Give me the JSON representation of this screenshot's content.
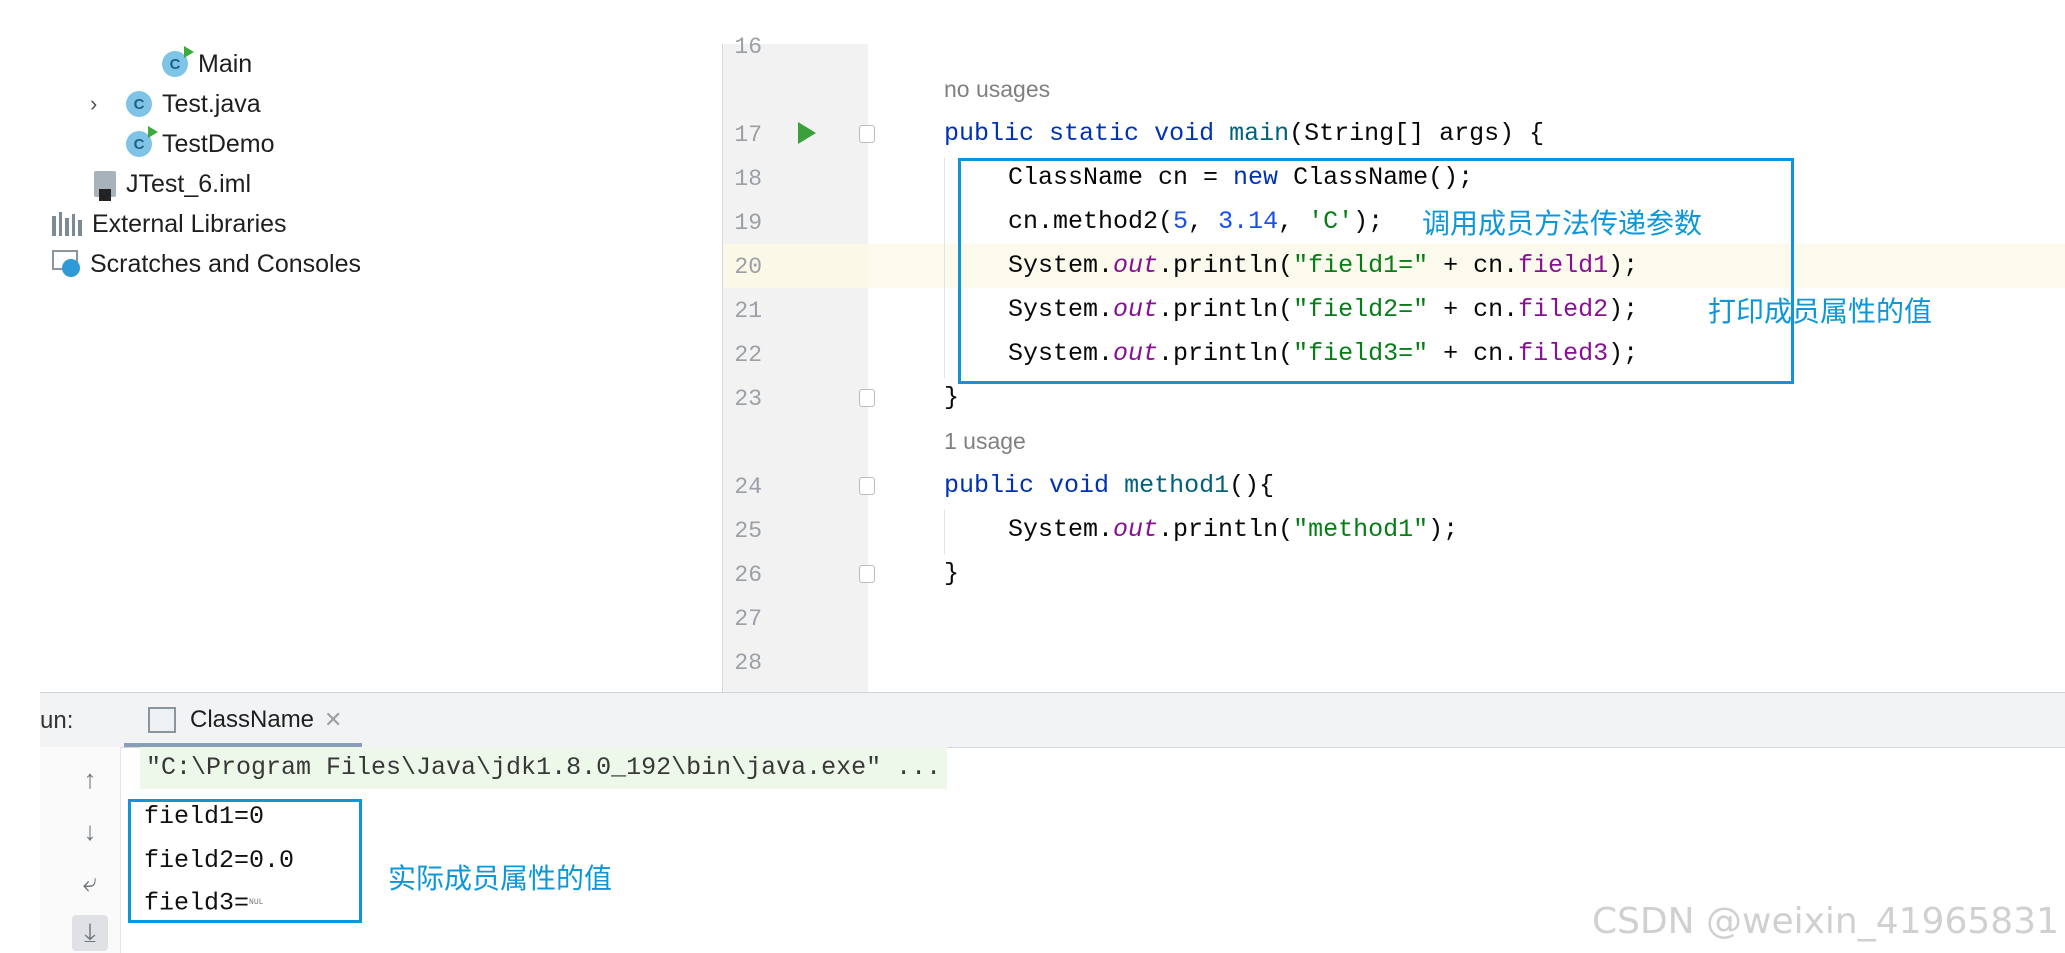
{
  "project_tree": {
    "items": [
      {
        "label": "Main",
        "icon": "java-class-run-icon"
      },
      {
        "label": "Test.java",
        "icon": "java-class-icon",
        "collapsed": true
      },
      {
        "label": "TestDemo",
        "icon": "java-class-run-icon"
      },
      {
        "label": "JTest_6.iml",
        "icon": "iml-file-icon"
      },
      {
        "label": "External Libraries",
        "icon": "libraries-icon"
      },
      {
        "label": "Scratches and Consoles",
        "icon": "scratches-icon"
      }
    ]
  },
  "editor": {
    "line_numbers": [
      "16",
      "17",
      "18",
      "19",
      "20",
      "21",
      "22",
      "23",
      "24",
      "25",
      "26",
      "27",
      "28"
    ],
    "hints": {
      "no_usages": "no usages",
      "one_usage": "1 usage"
    },
    "code": {
      "l17": {
        "kw1": "public",
        "kw2": "static",
        "kw3": "void",
        "name": "main",
        "rest": "(String[] args) {"
      },
      "l18": {
        "a": "ClassName cn = ",
        "kw": "new",
        "b": " ClassName();"
      },
      "l19": {
        "a": "cn.method2(",
        "n1": "5",
        "sep1": ", ",
        "n2": "3.14",
        "sep2": ", ",
        "s": "'C'",
        "b": ");"
      },
      "l20": {
        "a": "System.",
        "out": "out",
        "b": ".println(",
        "s": "\"field1=\"",
        "c": " + cn.",
        "f": "field1",
        "d": ");"
      },
      "l21": {
        "a": "System.",
        "out": "out",
        "b": ".println(",
        "s": "\"field2=\"",
        "c": " + cn.",
        "f": "filed2",
        "d": ");"
      },
      "l22": {
        "a": "System.",
        "out": "out",
        "b": ".println(",
        "s": "\"field3=\"",
        "c": " + cn.",
        "f": "filed3",
        "d": ");"
      },
      "l23": "}",
      "l24": {
        "kw1": "public",
        "kw2": "void",
        "name": "method1",
        "rest": "(){"
      },
      "l25": {
        "a": "System.",
        "out": "out",
        "b": ".println(",
        "s": "\"method1\"",
        "d": ");"
      },
      "l26": "}"
    },
    "annotations": {
      "call_method": "调用成员方法传递参数",
      "print_fields": "打印成员属性的值"
    }
  },
  "run_panel": {
    "label": "un:",
    "tab_label": "ClassName",
    "command": "\"C:\\Program Files\\Java\\jdk1.8.0_192\\bin\\java.exe\" ...",
    "output": [
      "field1=0",
      "field2=0.0",
      "field3="
    ],
    "nul_glyph": "NUL",
    "annotation": "实际成员属性的值"
  },
  "watermark": "CSDN @weixin_41965831",
  "colors": {
    "accent_annotation": "#0d96d8",
    "keyword": "#0033b3",
    "string": "#067d17",
    "number": "#1750eb",
    "field": "#871094"
  }
}
